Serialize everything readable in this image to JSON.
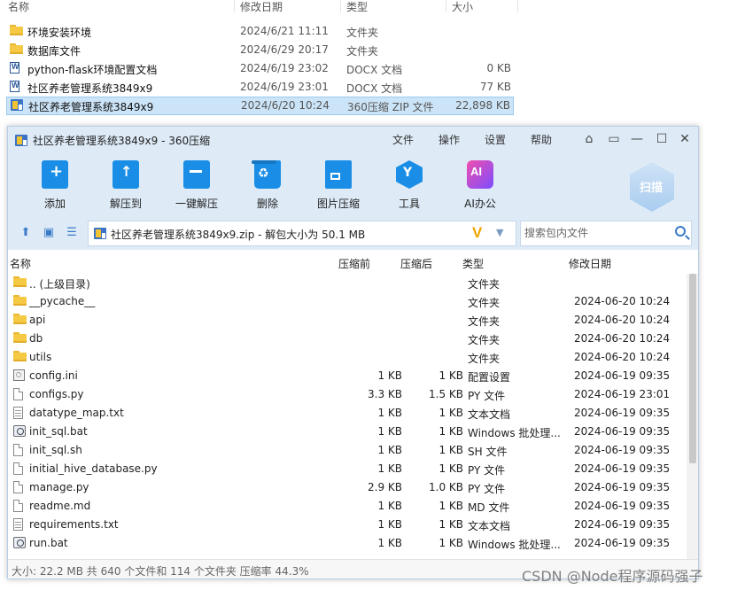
{
  "explorer": {
    "headers": {
      "name": "名称",
      "date": "修改日期",
      "type": "类型",
      "size": "大小"
    },
    "rows": [
      {
        "name": "环境安装环境",
        "date": "2024/6/21 11:11",
        "type": "文件夹",
        "size": "",
        "icon": "folder-icon"
      },
      {
        "name": "数据库文件",
        "date": "2024/6/29 20:17",
        "type": "文件夹",
        "size": "",
        "icon": "folder-icon"
      },
      {
        "name": "python-flask环境配置文档",
        "date": "2024/6/19 23:02",
        "type": "DOCX 文档",
        "size": "0 KB",
        "icon": "docx-icon"
      },
      {
        "name": "社区养老管理系统3849x9",
        "date": "2024/6/19 23:01",
        "type": "DOCX 文档",
        "size": "77 KB",
        "icon": "docx-icon"
      },
      {
        "name": "社区养老管理系统3849x9",
        "date": "2024/6/20 10:24",
        "type": "360压缩 ZIP 文件",
        "size": "22,898 KB",
        "icon": "zip-icon"
      }
    ]
  },
  "window": {
    "title": "社区养老管理系统3849x9 - 360压缩",
    "menu": [
      "文件",
      "操作",
      "设置",
      "帮助"
    ],
    "toolbar": [
      "添加",
      "解压到",
      "一键解压",
      "删除",
      "图片压缩",
      "工具",
      "AI办公"
    ],
    "scan_label": "扫描",
    "address": "社区养老管理系统3849x9.zip - 解包大小为 50.1 MB",
    "search_placeholder": "搜索包内文件",
    "columns": {
      "name": "名称",
      "before": "压缩前",
      "after": "压缩后",
      "type": "类型",
      "date": "修改日期"
    },
    "files": [
      {
        "name": ".. (上级目录)",
        "before": "",
        "after": "",
        "type": "文件夹",
        "date": "",
        "icon": "folder-icon"
      },
      {
        "name": "__pycache__",
        "before": "",
        "after": "",
        "type": "文件夹",
        "date": "2024-06-20 10:24",
        "icon": "folder-icon"
      },
      {
        "name": "api",
        "before": "",
        "after": "",
        "type": "文件夹",
        "date": "2024-06-20 10:24",
        "icon": "folder-icon"
      },
      {
        "name": "db",
        "before": "",
        "after": "",
        "type": "文件夹",
        "date": "2024-06-20 10:24",
        "icon": "folder-icon"
      },
      {
        "name": "utils",
        "before": "",
        "after": "",
        "type": "文件夹",
        "date": "2024-06-20 10:24",
        "icon": "folder-icon"
      },
      {
        "name": "config.ini",
        "before": "1 KB",
        "after": "1 KB",
        "type": "配置设置",
        "date": "2024-06-19 09:35",
        "icon": "settings-file-icon"
      },
      {
        "name": "configs.py",
        "before": "3.3 KB",
        "after": "1.5 KB",
        "type": "PY 文件",
        "date": "2024-06-19 23:01",
        "icon": "file-icon"
      },
      {
        "name": "datatype_map.txt",
        "before": "1 KB",
        "after": "1 KB",
        "type": "文本文档",
        "date": "2024-06-19 09:35",
        "icon": "text-file-icon"
      },
      {
        "name": "init_sql.bat",
        "before": "1 KB",
        "after": "1 KB",
        "type": "Windows 批处理...",
        "date": "2024-06-19 09:35",
        "icon": "batch-file-icon"
      },
      {
        "name": "init_sql.sh",
        "before": "1 KB",
        "after": "1 KB",
        "type": "SH 文件",
        "date": "2024-06-19 09:35",
        "icon": "file-icon"
      },
      {
        "name": "initial_hive_database.py",
        "before": "1 KB",
        "after": "1 KB",
        "type": "PY 文件",
        "date": "2024-06-19 09:35",
        "icon": "file-icon"
      },
      {
        "name": "manage.py",
        "before": "2.9 KB",
        "after": "1.0 KB",
        "type": "PY 文件",
        "date": "2024-06-19 09:35",
        "icon": "file-icon"
      },
      {
        "name": "readme.md",
        "before": "1 KB",
        "after": "1 KB",
        "type": "MD 文件",
        "date": "2024-06-19 09:35",
        "icon": "file-icon"
      },
      {
        "name": "requirements.txt",
        "before": "1 KB",
        "after": "1 KB",
        "type": "文本文档",
        "date": "2024-06-19 09:35",
        "icon": "text-file-icon"
      },
      {
        "name": "run.bat",
        "before": "1 KB",
        "after": "1 KB",
        "type": "Windows 批处理...",
        "date": "2024-06-19 09:35",
        "icon": "batch-file-icon"
      }
    ],
    "status": "大小: 22.2 MB 共 640 个文件和 114 个文件夹 压缩率 44.3%"
  },
  "watermark": "CSDN @Node程序源码强子"
}
